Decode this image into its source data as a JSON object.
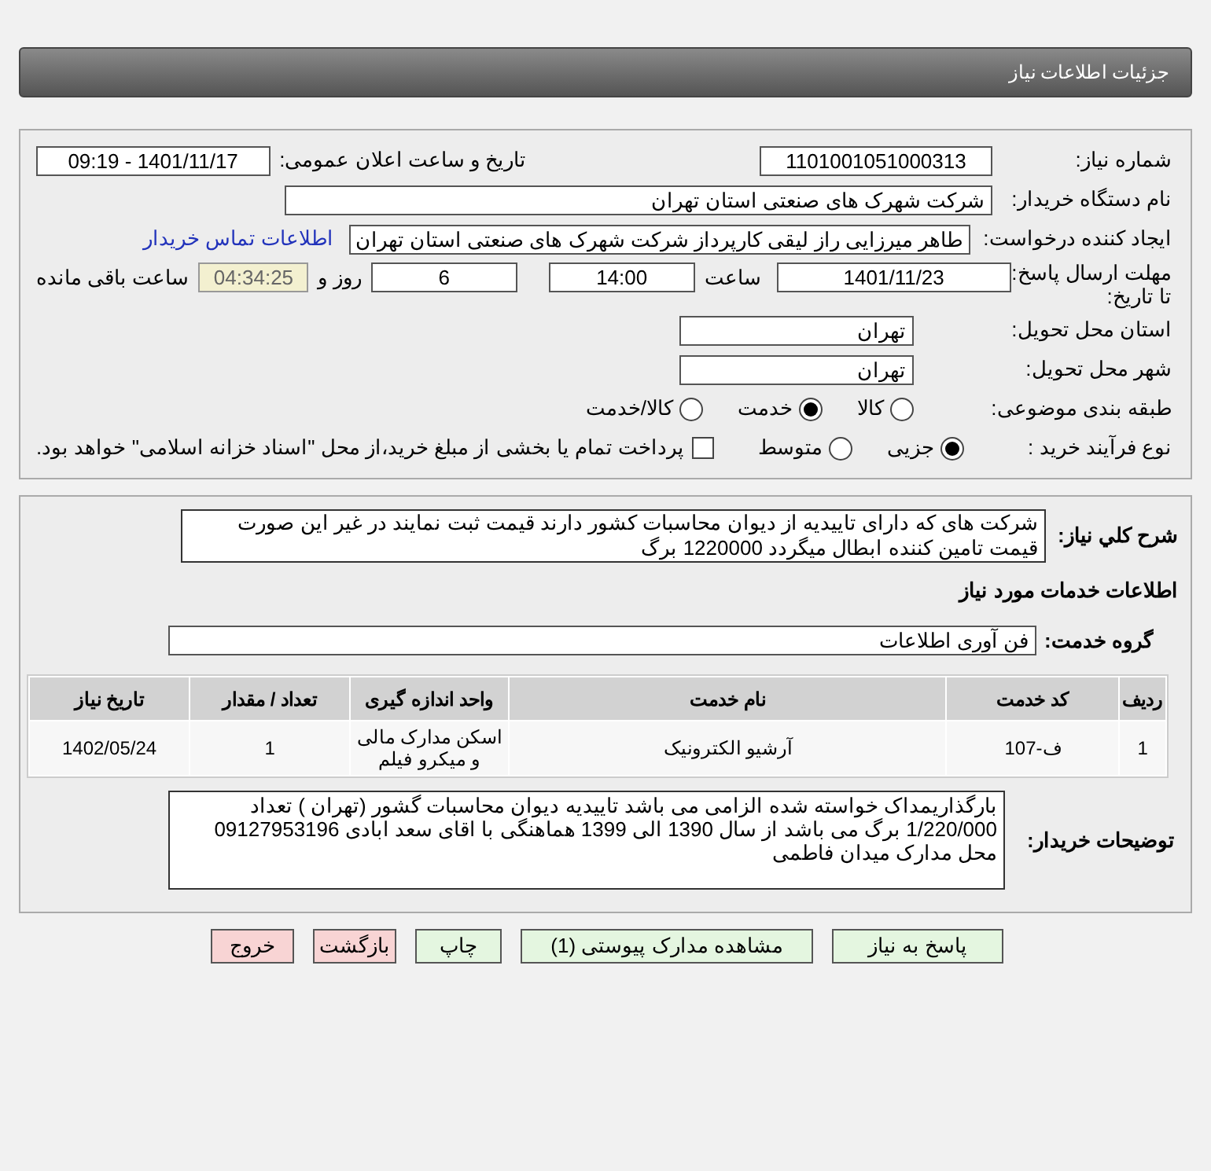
{
  "header": {
    "title": "جزئیات اطلاعات نیاز"
  },
  "details": {
    "need_number": {
      "label": "شماره نیاز:",
      "value": "1101001051000313"
    },
    "announce": {
      "label": "تاریخ و ساعت اعلان عمومی:",
      "value": "1401/11/17 - 09:19"
    },
    "buyer": {
      "label": "نام دستگاه خریدار:",
      "value": "شرکت شهرک های صنعتی استان تهران"
    },
    "creator": {
      "label": "ایجاد کننده درخواست:",
      "value": "طاهر  میرزایی راز لیقی کارپرداز شرکت شهرک های صنعتی استان تهران",
      "link": "اطلاعات تماس خریدار"
    },
    "deadline": {
      "label": "مهلت ارسال پاسخ: تا تاریخ:",
      "date": "1401/11/23",
      "time_label": "ساعت",
      "time": "14:00",
      "days": "6",
      "days_label": "روز و",
      "remaining": "04:34:25",
      "remaining_label": "ساعت باقی مانده"
    },
    "province": {
      "label": "استان محل تحویل:",
      "value": "تهران"
    },
    "city": {
      "label": "شهر محل تحویل:",
      "value": "تهران"
    },
    "category": {
      "label": "طبقه بندی موضوعی:",
      "options": [
        {
          "label": "کالا",
          "selected": false
        },
        {
          "label": "خدمت",
          "selected": true
        },
        {
          "label": "کالا/خدمت",
          "selected": false
        }
      ]
    },
    "process": {
      "label": "نوع فرآیند خرید :",
      "options": [
        {
          "label": "جزیی",
          "selected": true
        },
        {
          "label": "متوسط",
          "selected": false
        }
      ],
      "payment": {
        "label": "پرداخت تمام یا بخشی از مبلغ خرید،از محل \"اسناد خزانه اسلامی\" خواهد بود.",
        "checked": false
      }
    }
  },
  "summary": {
    "label": "شرح کلي نياز:",
    "text": "شرکت های که دارای تاییدیه از دیوان محاسبات کشور  دارند قیمت ثبت نمایند در غیر این صورت قیمت تامین کننده ابطال میگردد  1220000 برگ"
  },
  "services_heading": "اطلاعات خدمات مورد نیاز",
  "service_group": {
    "label": "گروه خدمت:",
    "value": "فن آوری اطلاعات"
  },
  "table": {
    "columns": [
      "ردیف",
      "کد خدمت",
      "نام خدمت",
      "واحد اندازه گیری",
      "تعداد / مقدار",
      "تاریخ نیاز"
    ],
    "rows": [
      [
        "1",
        "ف-107",
        "آرشیو الکترونیک",
        "اسکن مدارک مالی و میکرو فیلم",
        "1",
        "1402/05/24"
      ]
    ]
  },
  "buyer_notes": {
    "label": "توضیحات خریدار:",
    "text": "بارگذاریمداک خواسته شده الزامی می باشد  تاییدیه دیوان محاسبات گشور (تهران ) تعداد 1/220/000 برگ می باشد  از سال 1390 الی 1399    هماهنگی با اقای سعد ابادی 09127953196  محل مدارک میدان فاطمی"
  },
  "buttons": [
    {
      "label": "پاسخ به نیاز",
      "kind": "primary"
    },
    {
      "label": "مشاهده مدارک پیوستی (1)",
      "kind": "primary"
    },
    {
      "label": "چاپ",
      "kind": "primary"
    },
    {
      "label": "بازگشت",
      "kind": "danger"
    },
    {
      "label": "خروج",
      "kind": "danger"
    }
  ]
}
